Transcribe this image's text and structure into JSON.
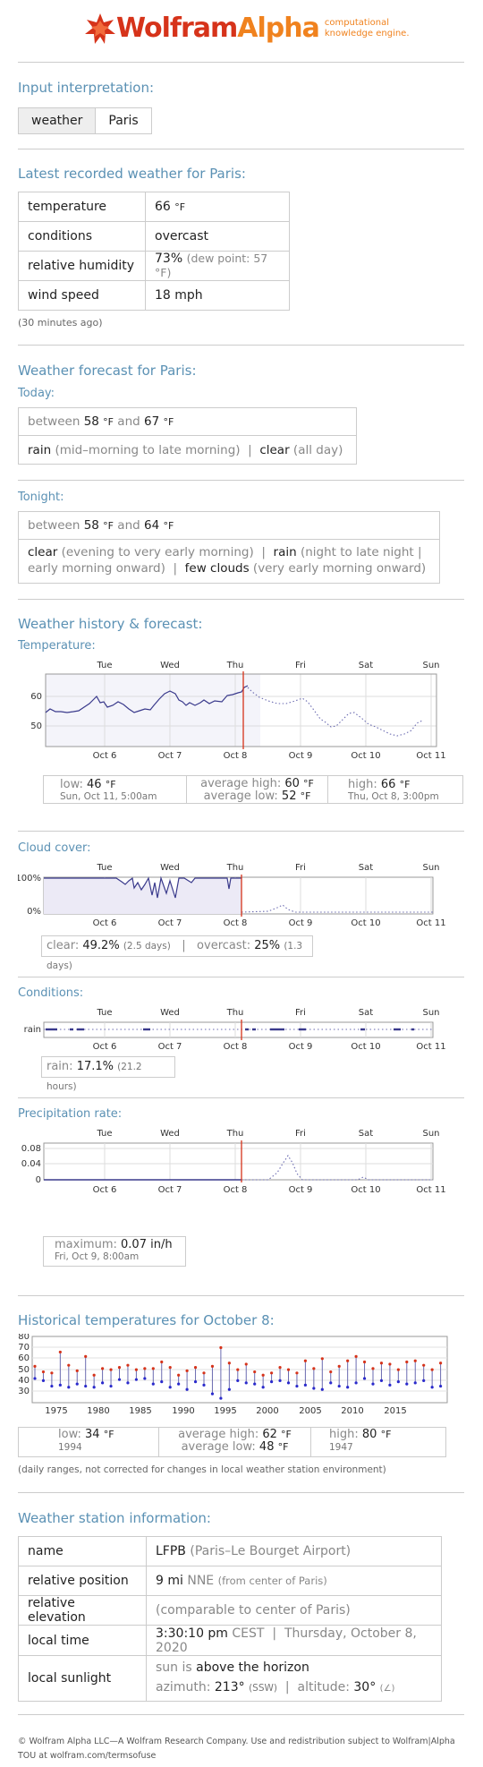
{
  "header": {
    "brand_part1": "Wolfram",
    "brand_part2": "Alpha",
    "tagline_line1": "computational",
    "tagline_line2": "knowledge engine."
  },
  "input": {
    "title": "Input interpretation:",
    "buttons": [
      "weather",
      "Paris"
    ]
  },
  "latest": {
    "title": "Latest recorded weather for Paris:",
    "rows": [
      {
        "label": "temperature",
        "value": "66",
        "unit": "°F",
        "extra": ""
      },
      {
        "label": "conditions",
        "value": "overcast",
        "unit": "",
        "extra": ""
      },
      {
        "label": "relative humidity",
        "value": "73%",
        "unit": "",
        "extra": "(dew point: 57 °F)"
      },
      {
        "label": "wind speed",
        "value": "18 mph",
        "unit": "",
        "extra": ""
      }
    ],
    "note": "(30 minutes ago)"
  },
  "forecast": {
    "title": "Weather forecast for Paris:",
    "today_label": "Today:",
    "today_between": "between",
    "today_low": "58",
    "today_and": "and",
    "today_high": "67",
    "unit": "°F",
    "today_cond1": "rain",
    "today_cond1_detail": "(mid–morning to late morning)",
    "today_cond2": "clear",
    "today_cond2_detail": "(all day)",
    "tonight_label": "Tonight:",
    "tonight_low": "58",
    "tonight_high": "64",
    "tonight_cond1": "clear",
    "tonight_cond1_detail": "(evening to very early morning)",
    "tonight_cond2": "rain",
    "tonight_cond2_detail": "(night to late night  |",
    "tonight_cond2_detail2": "early morning onward)",
    "tonight_cond3": "few clouds",
    "tonight_cond3_detail": "(very early morning onward)"
  },
  "history": {
    "title": "Weather history & forecast:",
    "days": [
      "Tue",
      "Wed",
      "Thu",
      "Fri",
      "Sat",
      "Sun"
    ],
    "dates": [
      "Oct 6",
      "Oct 7",
      "Oct 8",
      "Oct 9",
      "Oct 10",
      "Oct 11"
    ],
    "temp_label": "Temperature:",
    "temp_low_label": "low:",
    "temp_low": "46",
    "temp_low_when": "Sun, Oct 11, 5:00am",
    "temp_avg_high_label": "average high:",
    "temp_avg_high": "60",
    "temp_avg_low_label": "average low:",
    "temp_avg_low": "52",
    "temp_high_label": "high:",
    "temp_high": "66",
    "temp_high_when": "Thu, Oct 8, 3:00pm",
    "cloud_label": "Cloud cover:",
    "cloud_clear_label": "clear:",
    "cloud_clear": "49.2%",
    "cloud_clear_days": "(2.5 days)",
    "cloud_overcast_label": "overcast:",
    "cloud_overcast": "25%",
    "cloud_overcast_days": "(1.3 days)",
    "cond_label": "Conditions:",
    "cond_axis": "rain",
    "cond_rain_label": "rain:",
    "cond_rain": "17.1%",
    "cond_rain_hours": "(21.2 hours)",
    "precip_label": "Precipitation rate:",
    "precip_max_label": "maximum:",
    "precip_max": "0.07 in/h",
    "precip_max_when": "Fri, Oct 9, 8:00am"
  },
  "historical": {
    "title": "Historical temperatures for October 8:",
    "low_label": "low:",
    "low": "34",
    "low_year": "1994",
    "avg_high_label": "average high:",
    "avg_high": "62",
    "avg_low_label": "average low:",
    "avg_low": "48",
    "high_label": "high:",
    "high": "80",
    "high_year": "1947",
    "note": "(daily ranges, not corrected for changes in local weather station environment)"
  },
  "station": {
    "title": "Weather station information:",
    "name_label": "name",
    "name_code": "LFPB",
    "name_detail": "(Paris–Le Bourget Airport)",
    "pos_label": "relative position",
    "pos_dist": "9 mi",
    "pos_dir": "NNE",
    "pos_detail": "(from center of Paris)",
    "elev_label": "relative elevation",
    "elev_detail": "(comparable to center of Paris)",
    "time_label": "local time",
    "time_value": "3:30:10 pm",
    "time_zone": "CEST",
    "time_date": "Thursday, October 8, 2020",
    "sun_label": "local sunlight",
    "sun_line1": "sun is",
    "sun_line1b": "above the horizon",
    "sun_az_label": "azimuth:",
    "sun_az": "213°",
    "sun_az_dir": "(SSW)",
    "sun_alt_label": "altitude:",
    "sun_alt": "30°"
  },
  "footer": {
    "line1": "© Wolfram Alpha LLC—A Wolfram Research Company. Use and redistribution subject to Wolfram|Alpha",
    "line2": "TOU at wolfram.com/termsofuse"
  },
  "chart_data": [
    {
      "type": "line",
      "title": "Temperature",
      "ylabel": "",
      "ylim": [
        40,
        70
      ],
      "yticks": [
        50,
        60
      ],
      "x": [
        "Oct 6",
        "Oct 7",
        "Oct 8",
        "Oct 9",
        "Oct 10",
        "Oct 11"
      ],
      "series": []
    },
    {
      "type": "area",
      "title": "Cloud cover",
      "yticks": [
        "0%",
        "100%"
      ]
    },
    {
      "type": "line",
      "title": "Precipitation rate",
      "yticks": [
        0,
        0.04,
        0.08
      ]
    },
    {
      "type": "bar",
      "title": "Historical temperatures for October 8",
      "ylim": [
        30,
        80
      ],
      "yticks": [
        30,
        40,
        50,
        60,
        70,
        80
      ],
      "xticks": [
        1975,
        1980,
        1985,
        1990,
        1995,
        2000,
        2005,
        2010,
        2015
      ]
    }
  ]
}
